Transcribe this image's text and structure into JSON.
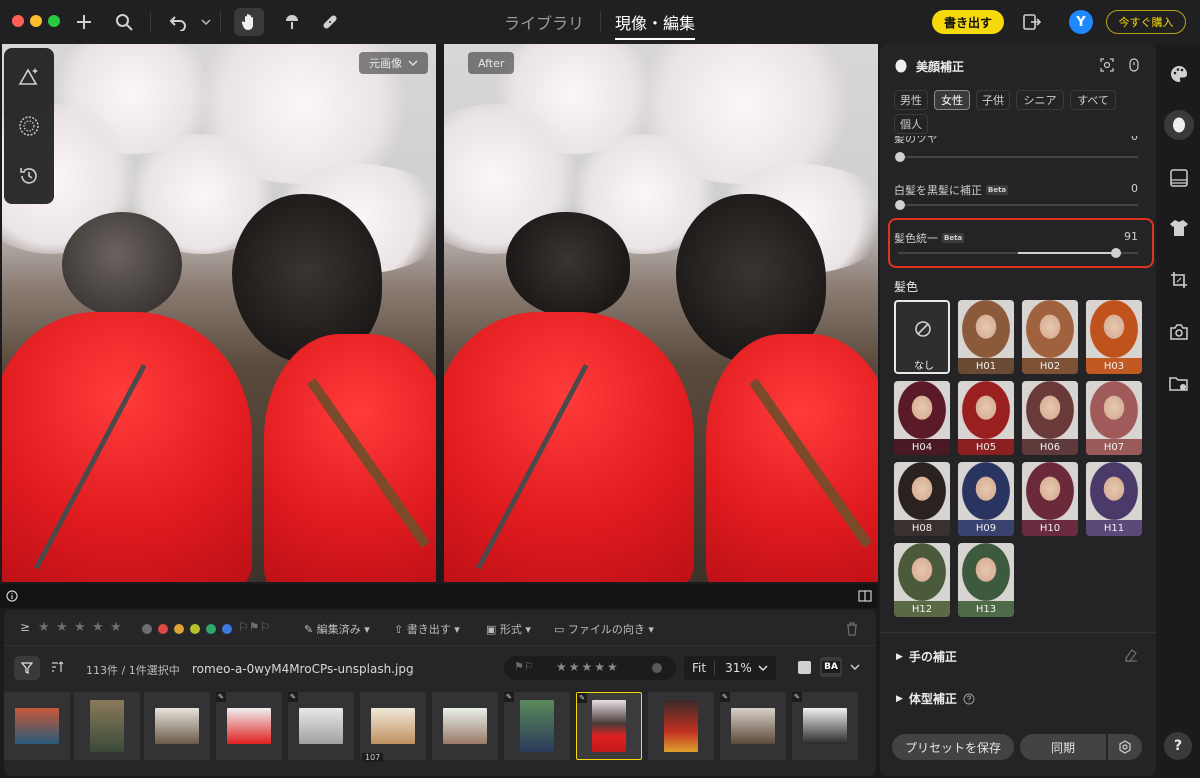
{
  "tabs": {
    "library": "ライブラリ",
    "develop": "現像・編集"
  },
  "header": {
    "export_label": "書き出す",
    "avatar_initial": "Y",
    "buy_label": "今すぐ購入"
  },
  "viewer": {
    "before_label": "元画像",
    "after_label": "After"
  },
  "filmbar": {
    "edited_label": "編集済み",
    "export_label": "書き出す",
    "format_label": "形式",
    "orientation_label": "ファイルの向き",
    "count_text": "113件 / 1件選択中",
    "filename": "romeo-a-0wyM4MroCPs-unsplash.jpg",
    "fit_label": "Fit",
    "zoom_value": "31%",
    "ba_label": "BA",
    "stack_count": "107",
    "color_labels": [
      "#e04848",
      "#e0a436",
      "#b8c02a",
      "#2ea86a",
      "#3a7be0"
    ]
  },
  "panel": {
    "title": "美顔補正",
    "chips": [
      "男性",
      "女性",
      "子供",
      "シニア",
      "すべて",
      "個人"
    ],
    "active_chip": "女性",
    "hair_gloss": {
      "label": "髪のツヤ",
      "value": "0"
    },
    "gray_to_black": {
      "label": "白髪を黒髪に補正",
      "badge": "Beta",
      "value": "0"
    },
    "hair_unify": {
      "label": "髪色統一",
      "badge": "Beta",
      "value": "91"
    },
    "hair_color_title": "髪色",
    "none_label": "なし",
    "swatches": [
      {
        "label": "H01",
        "color": "#8a5a3a",
        "bar": "#6b4a33"
      },
      {
        "label": "H02",
        "color": "#a0623e",
        "bar": "#7f5236"
      },
      {
        "label": "H03",
        "color": "#c0521e",
        "bar": "#c05a22"
      },
      {
        "label": "H04",
        "color": "#5a1a28",
        "bar": "#4a1a24"
      },
      {
        "label": "H05",
        "color": "#9a1f1f",
        "bar": "#8a2020"
      },
      {
        "label": "H06",
        "color": "#6a3a3a",
        "bar": "#5e3a3a"
      },
      {
        "label": "H07",
        "color": "#a05a5a",
        "bar": "#9a5a5a"
      },
      {
        "label": "H08",
        "color": "#2a2220",
        "bar": "#3a3030"
      },
      {
        "label": "H09",
        "color": "#2a3460",
        "bar": "#3a4270"
      },
      {
        "label": "H10",
        "color": "#6a2a3a",
        "bar": "#6a2a40"
      },
      {
        "label": "H11",
        "color": "#4a3a6a",
        "bar": "#5a4a7a"
      },
      {
        "label": "H12",
        "color": "#4a5a3a",
        "bar": "#5a6a44"
      },
      {
        "label": "H13",
        "color": "#3e5a3e",
        "bar": "#4e6a46"
      }
    ],
    "hand_label": "手の補正",
    "body_label": "体型補正",
    "save_preset_label": "プリセットを保存",
    "sync_label": "同期"
  },
  "help_label": "?"
}
